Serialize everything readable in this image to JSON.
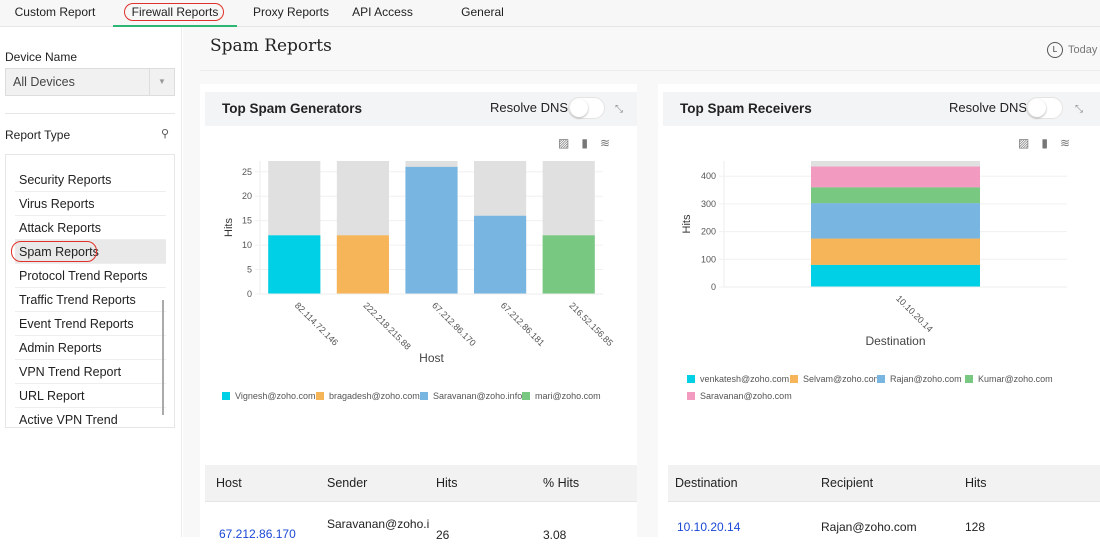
{
  "nav": {
    "tabs": [
      {
        "label": "Custom Report"
      },
      {
        "label": "Firewall Reports",
        "active": true
      },
      {
        "label": "Proxy Reports"
      },
      {
        "label": "API Access"
      },
      {
        "label": "General"
      }
    ]
  },
  "sidebar": {
    "device_label": "Device Name",
    "device_value": "All Devices",
    "report_type_label": "Report Type",
    "items": [
      {
        "label": "Security Reports"
      },
      {
        "label": "Virus Reports"
      },
      {
        "label": "Attack Reports"
      },
      {
        "label": "Spam Reports",
        "selected": true
      },
      {
        "label": "Protocol Trend Reports"
      },
      {
        "label": "Traffic Trend Reports"
      },
      {
        "label": "Event Trend Reports"
      },
      {
        "label": "Admin Reports"
      },
      {
        "label": "VPN Trend Report"
      },
      {
        "label": "URL Report"
      },
      {
        "label": "Active VPN Trend"
      }
    ]
  },
  "header": {
    "title": "Spam Reports",
    "period": "Today",
    "period_icon": "L"
  },
  "panels": [
    {
      "title": "Top Spam Generators",
      "resolve_dns": "Resolve DNS",
      "table": {
        "headers": [
          "Host",
          "Sender",
          "Hits",
          "% Hits"
        ],
        "rows": [
          [
            "67.212.86.170",
            "Saravanan@zoho.i",
            "26",
            "3.08"
          ]
        ]
      }
    },
    {
      "title": "Top Spam Receivers",
      "resolve_dns": "Resolve DNS",
      "table": {
        "headers": [
          "Destination",
          "Recipient",
          "Hits"
        ],
        "rows": [
          [
            "10.10.20.14",
            "Rajan@zoho.com",
            "128"
          ]
        ]
      }
    }
  ],
  "chart_data": [
    {
      "type": "bar",
      "xlabel": "Host",
      "ylabel": "Hits",
      "ylim": [
        0,
        27.2
      ],
      "yticks": [
        0,
        5,
        10,
        15,
        20,
        25
      ],
      "grid": true,
      "legend": "bottom",
      "background_bar_max": 27.2,
      "categories": [
        "82.114.72.146",
        "222.218.215.88",
        "67.212.86.170",
        "67.212.86.181",
        "216.52.156.85"
      ],
      "series": [
        {
          "name": "Vignesh@zoho.com",
          "color": "#00d0e6",
          "values": [
            12,
            0,
            0,
            0,
            0
          ]
        },
        {
          "name": "bragadesh@zoho.com",
          "color": "#f7b55a",
          "values": [
            0,
            12,
            0,
            0,
            0
          ]
        },
        {
          "name": "Saravanan@zoho.info",
          "color": "#78b5e0",
          "values": [
            0,
            0,
            26,
            16,
            0
          ]
        },
        {
          "name": "mari@zoho.com",
          "color": "#78c882",
          "values": [
            0,
            0,
            0,
            0,
            12
          ]
        }
      ]
    },
    {
      "type": "bar",
      "stacked": true,
      "xlabel": "Destination",
      "ylabel": "Hits",
      "ylim": [
        0,
        455
      ],
      "yticks": [
        0,
        100,
        200,
        300,
        400
      ],
      "grid": true,
      "legend": "bottom",
      "background_bar_max": 455,
      "categories": [
        "10.10.20.14"
      ],
      "series": [
        {
          "name": "venkatesh@zoho.com",
          "color": "#00d0e6",
          "values": [
            80
          ]
        },
        {
          "name": "Selvam@zoho.com",
          "color": "#f7b55a",
          "values": [
            95
          ]
        },
        {
          "name": "Rajan@zoho.com",
          "color": "#78b5e0",
          "values": [
            128
          ]
        },
        {
          "name": "Kumar@zoho.com",
          "color": "#78c882",
          "values": [
            57
          ]
        },
        {
          "name": "Saravanan@zoho.com",
          "color": "#f29abf",
          "values": [
            75
          ]
        }
      ]
    }
  ],
  "colors": {
    "accent": "#2bb673",
    "highlight_circle": "#e0322a",
    "link": "#1a49d6"
  }
}
